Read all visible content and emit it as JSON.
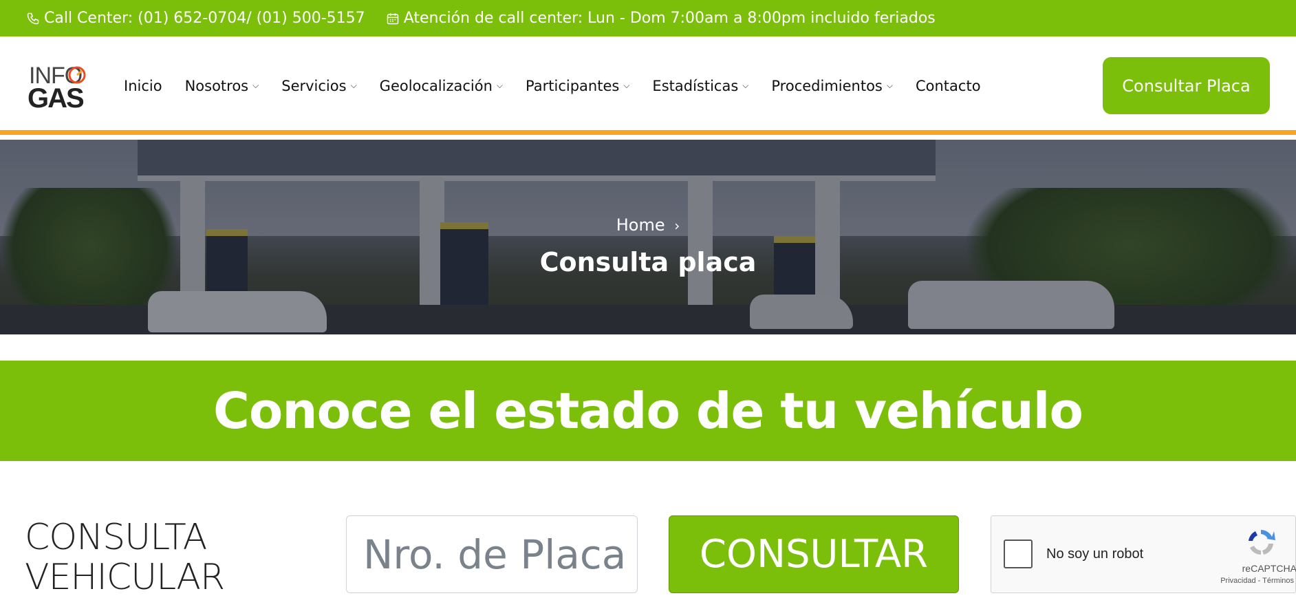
{
  "topbar": {
    "call_center": "Call Center: (01) 652-0704/ (01) 500-5157",
    "hours": "Atención de call center: Lun - Dom 7:00am a 8:00pm incluido feriados"
  },
  "logo": {
    "line1": "INFO",
    "line2": "GAS"
  },
  "nav": {
    "items": [
      {
        "label": "Inicio",
        "dropdown": false
      },
      {
        "label": "Nosotros",
        "dropdown": true
      },
      {
        "label": "Servicios",
        "dropdown": true
      },
      {
        "label": "Geolocalización",
        "dropdown": true
      },
      {
        "label": "Participantes",
        "dropdown": true
      },
      {
        "label": "Estadísticas",
        "dropdown": true
      },
      {
        "label": "Procedimientos",
        "dropdown": true
      },
      {
        "label": "Contacto",
        "dropdown": false
      }
    ],
    "cta_label": "Consultar Placa"
  },
  "hero": {
    "breadcrumb": "Home",
    "title": "Consulta placa"
  },
  "banner": {
    "heading": "Conoce el estado de tu vehículo"
  },
  "form": {
    "section_line1": "CONSULTA",
    "section_line2": "VEHICULAR",
    "plate_placeholder": "Nro. de Placa",
    "submit_label": "CONSULTAR"
  },
  "captcha": {
    "label": "No soy un robot",
    "brand": "reCAPTCHA",
    "privacy": "Privacidad",
    "terms": "Términos"
  },
  "colors": {
    "brand_green": "#7bbf0a",
    "accent_orange": "#f6a623"
  }
}
